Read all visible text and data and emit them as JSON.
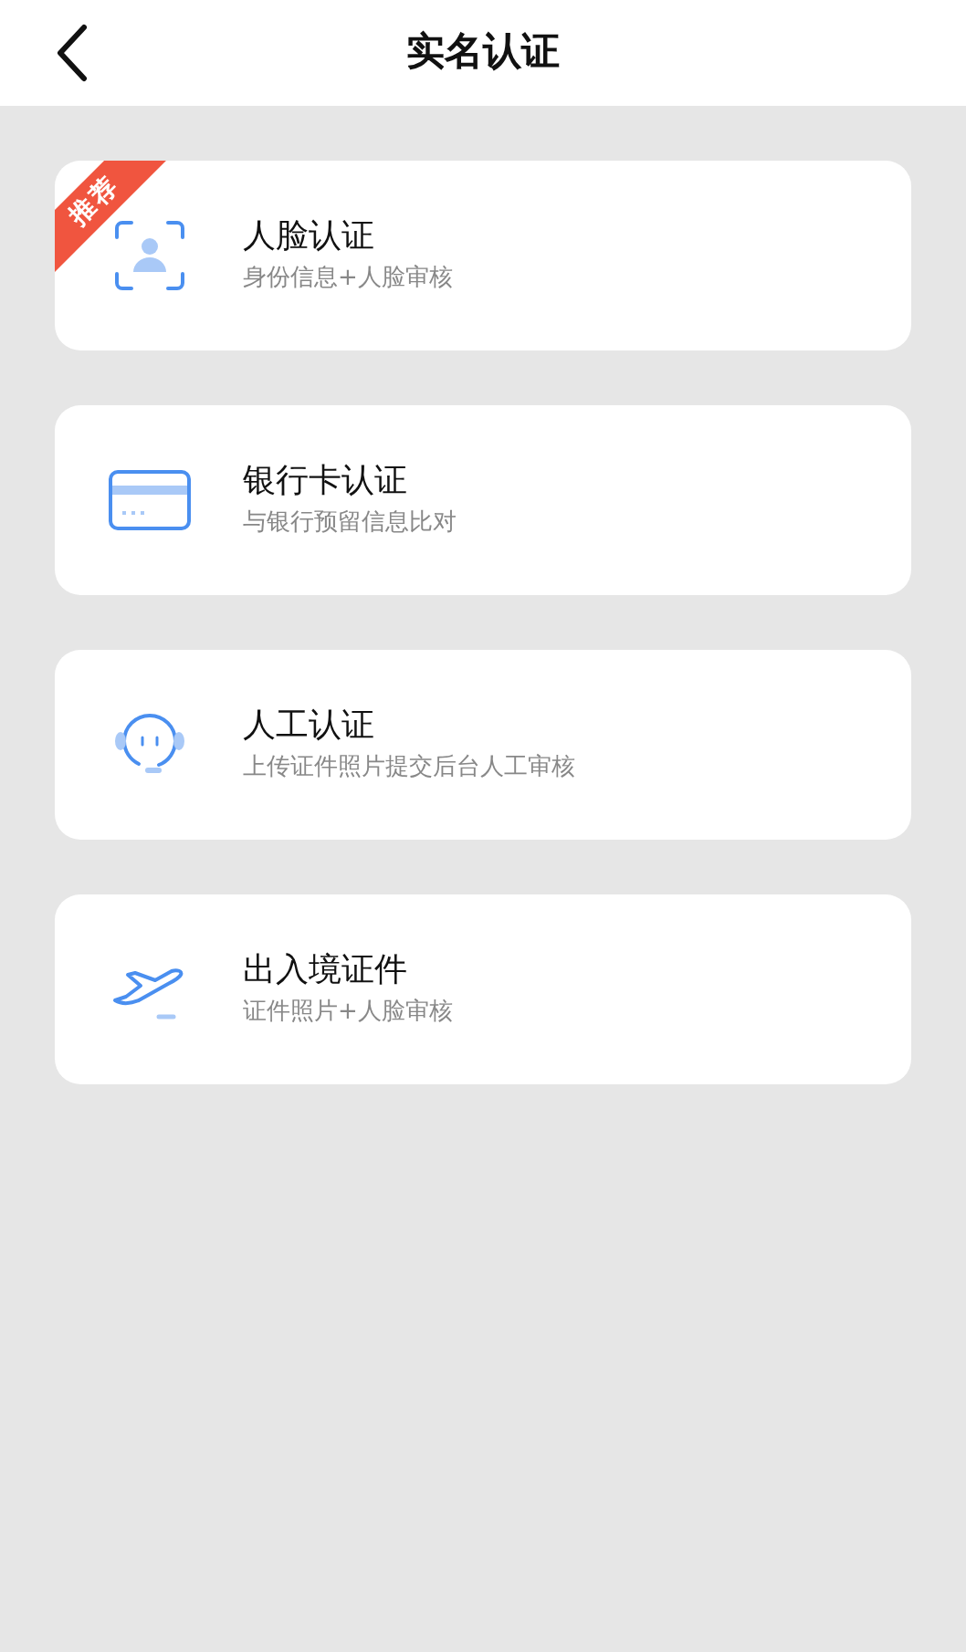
{
  "header": {
    "title": "实名认证"
  },
  "options": [
    {
      "kind": "face",
      "title": "人脸认证",
      "subtitle": "身份信息+人脸审核",
      "badge": "推荐"
    },
    {
      "kind": "card",
      "title": "银行卡认证",
      "subtitle": "与银行预留信息比对"
    },
    {
      "kind": "agent",
      "title": "人工认证",
      "subtitle": "上传证件照片提交后台人工审核"
    },
    {
      "kind": "plane",
      "title": "出入境证件",
      "subtitle": "证件照片+人脸审核"
    }
  ]
}
